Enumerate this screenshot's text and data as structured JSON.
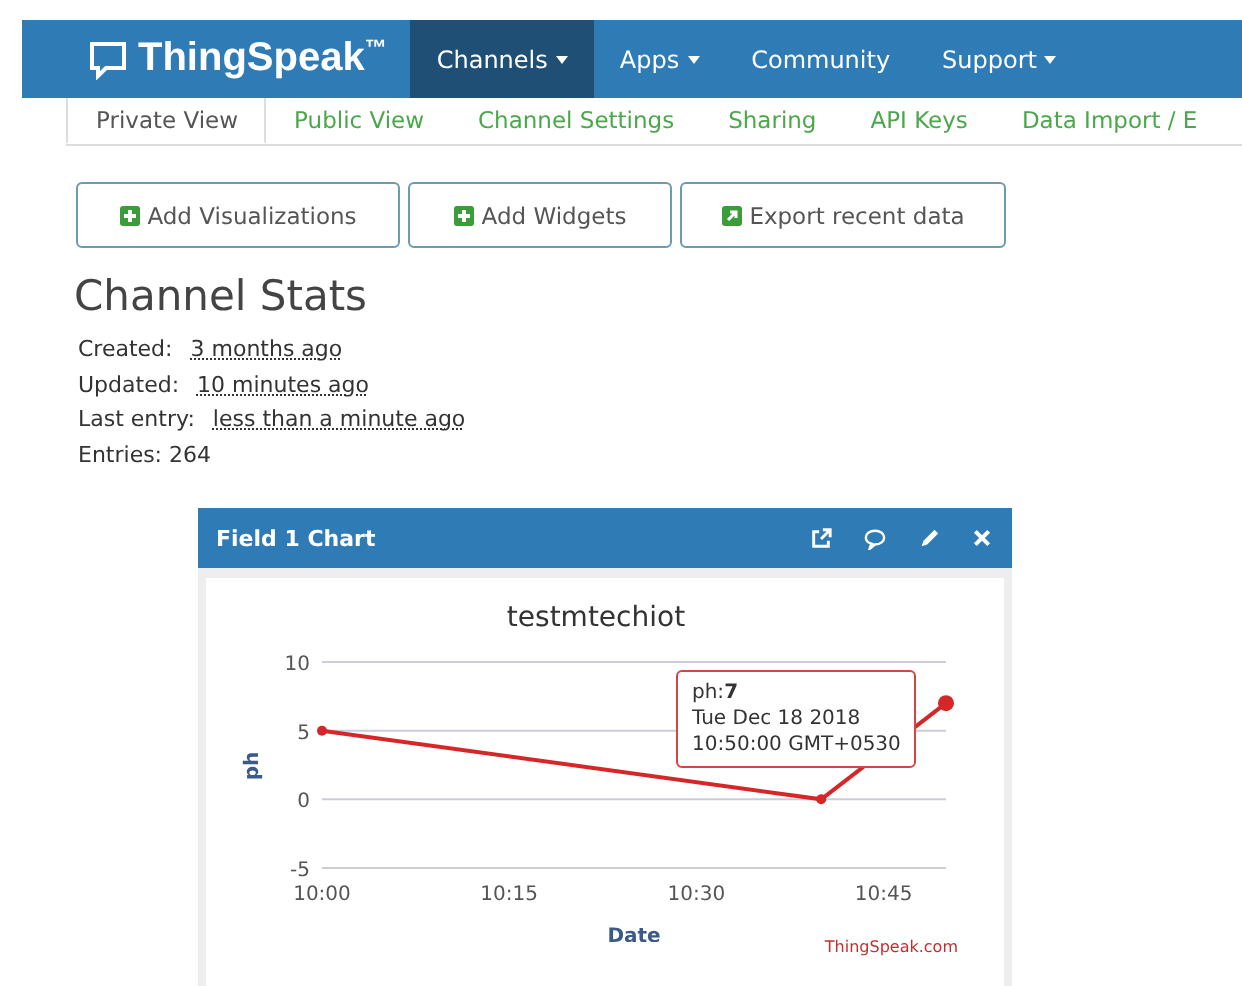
{
  "brand": {
    "name": "ThingSpeak",
    "mark": "™"
  },
  "nav": [
    {
      "label": "Channels",
      "dropdown": true,
      "selected": true
    },
    {
      "label": "Apps",
      "dropdown": true,
      "selected": false
    },
    {
      "label": "Community",
      "dropdown": false,
      "selected": false
    },
    {
      "label": "Support",
      "dropdown": true,
      "selected": false
    }
  ],
  "tabs": [
    {
      "label": "Private View",
      "selected": true
    },
    {
      "label": "Public View",
      "selected": false
    },
    {
      "label": "Channel Settings",
      "selected": false
    },
    {
      "label": "Sharing",
      "selected": false
    },
    {
      "label": "API Keys",
      "selected": false
    },
    {
      "label": "Data Import / E",
      "selected": false
    }
  ],
  "buttons": [
    {
      "label": "Add Visualizations",
      "kind": "plus"
    },
    {
      "label": "Add Widgets",
      "kind": "plus"
    },
    {
      "label": "Export recent data",
      "kind": "export"
    }
  ],
  "stats": {
    "title": "Channel Stats",
    "items": [
      {
        "label": "Created:",
        "value": "3 months ago"
      },
      {
        "label": "Updated:",
        "value": "10 minutes ago"
      },
      {
        "label": "Last entry:",
        "value": "less than a minute ago"
      },
      {
        "label": "Entries: 264"
      }
    ]
  },
  "panel": {
    "title": "Field 1 Chart",
    "chart_data": {
      "type": "line",
      "title": "testmtechiot",
      "xlabel": "Date",
      "ylabel": "ph",
      "categories": [
        "10:00",
        null,
        null,
        "10:15",
        null,
        null,
        "10:30",
        null,
        null,
        "10:45",
        null
      ],
      "series": [
        {
          "color": "#d62728",
          "marker": true,
          "values": [
            5,
            null,
            null,
            null,
            null,
            null,
            null,
            null,
            0,
            null,
            7
          ]
        }
      ],
      "ylim": [
        -5,
        10
      ],
      "yticks": [
        -5,
        0,
        5,
        10
      ]
    },
    "tooltip": {
      "series": "ph:",
      "value": "7",
      "date": "Tue Dec 18 2018",
      "time": "10:50:00 GMT+0530"
    },
    "credit": "ThingSpeak.com"
  }
}
